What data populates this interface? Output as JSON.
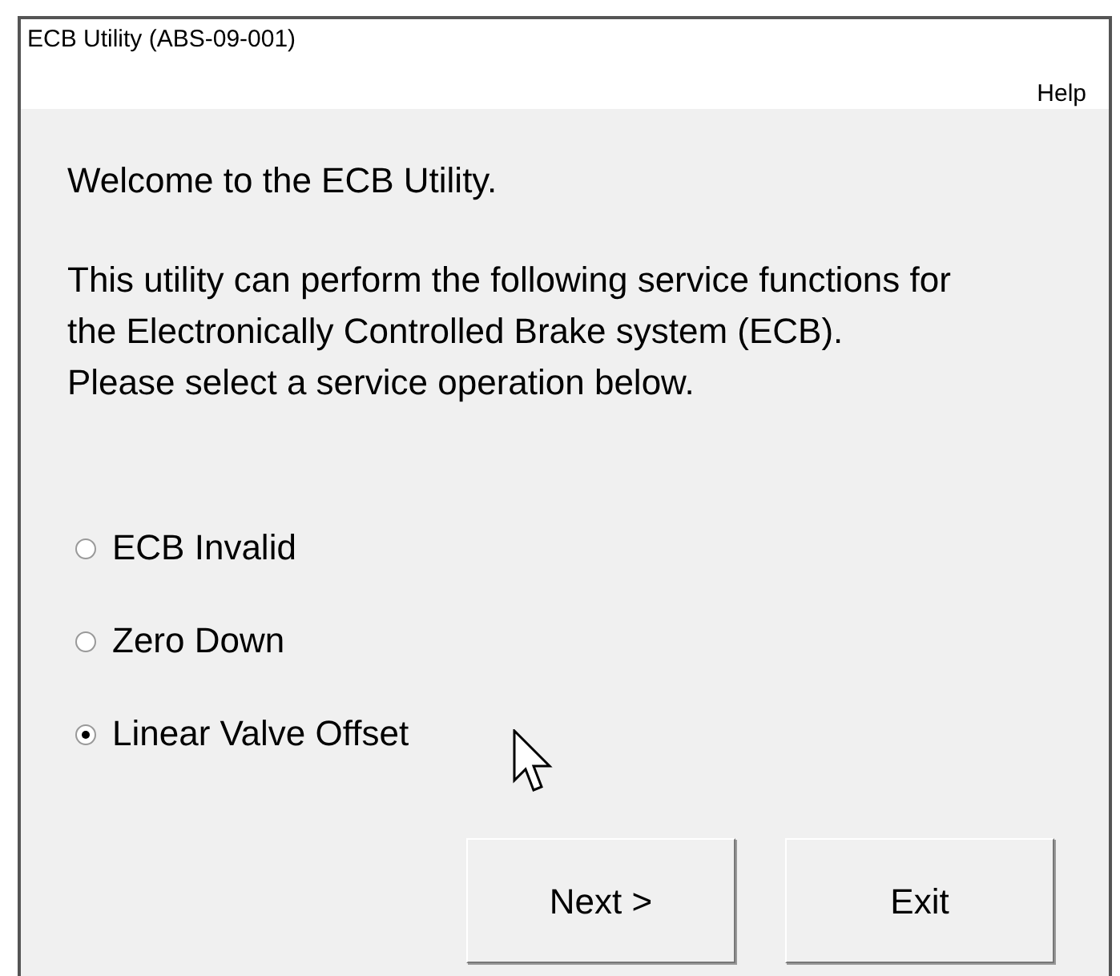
{
  "window": {
    "title": "ECB Utility (ABS-09-001)"
  },
  "menu": [
    "Help"
  ],
  "welcome": "Welcome to the ECB Utility.",
  "description": [
    "This utility can perform the following service functions for the Electronically Controlled Brake system (ECB).",
    "Please select a service operation below."
  ],
  "options": [
    {
      "label": "ECB Invalid",
      "selected": false
    },
    {
      "label": "Zero Down",
      "selected": false
    },
    {
      "label": "Linear Valve Offset",
      "selected": true
    }
  ],
  "buttons": [
    "Next >",
    "Exit"
  ]
}
